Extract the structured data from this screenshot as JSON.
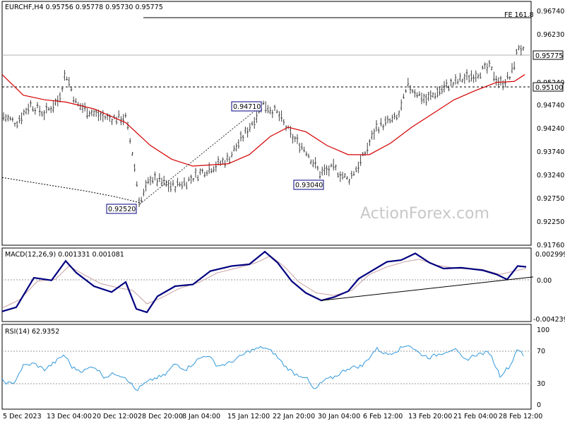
{
  "chart_data": {
    "type": "line",
    "watermark": "ActionForex.com",
    "price_panel": {
      "header": "EURCHF,H4  0.95756 0.95778 0.95730 0.95775",
      "ylim": [
        0.9162,
        0.9695
      ],
      "y_ticks": [
        "0.96740",
        "0.96230",
        "0.95775",
        "0.95240",
        "0.95100",
        "0.94740",
        "0.94240",
        "0.93740",
        "0.93240",
        "0.92750",
        "0.92250",
        "0.91760"
      ],
      "current_price": "0.95775",
      "support_level": "0.95100",
      "fe_label": "FE 161.8",
      "fe_level": 0.9659,
      "annotations": [
        {
          "text": "0.94710",
          "value": 0.9471
        },
        {
          "text": "0.93040",
          "value": 0.9304
        },
        {
          "text": "0.92520",
          "value": 0.9252
        }
      ],
      "price_path": [
        [
          0,
          0.9445
        ],
        [
          20,
          0.943
        ],
        [
          40,
          0.947
        ],
        [
          60,
          0.945
        ],
        [
          80,
          0.948
        ],
        [
          90,
          0.954
        ],
        [
          105,
          0.947
        ],
        [
          130,
          0.945
        ],
        [
          150,
          0.944
        ],
        [
          175,
          0.944
        ],
        [
          185,
          0.936
        ],
        [
          195,
          0.9252
        ],
        [
          210,
          0.931
        ],
        [
          240,
          0.929
        ],
        [
          260,
          0.93
        ],
        [
          280,
          0.932
        ],
        [
          320,
          0.935
        ],
        [
          350,
          0.942
        ],
        [
          370,
          0.9471
        ],
        [
          390,
          0.945
        ],
        [
          410,
          0.94
        ],
        [
          430,
          0.937
        ],
        [
          450,
          0.932
        ],
        [
          470,
          0.933
        ],
        [
          490,
          0.9304
        ],
        [
          510,
          0.935
        ],
        [
          530,
          0.942
        ],
        [
          560,
          0.944
        ],
        [
          575,
          0.951
        ],
        [
          600,
          0.948
        ],
        [
          630,
          0.951
        ],
        [
          660,
          0.953
        ],
        [
          690,
          0.955
        ],
        [
          705,
          0.9515
        ],
        [
          720,
          0.953
        ],
        [
          732,
          0.96
        ],
        [
          740,
          0.9578
        ]
      ],
      "ma_red": [
        [
          0,
          0.9535
        ],
        [
          30,
          0.949
        ],
        [
          60,
          0.948
        ],
        [
          90,
          0.9475
        ],
        [
          130,
          0.946
        ],
        [
          175,
          0.943
        ],
        [
          210,
          0.938
        ],
        [
          240,
          0.935
        ],
        [
          270,
          0.9335
        ],
        [
          320,
          0.934
        ],
        [
          350,
          0.936
        ],
        [
          380,
          0.94
        ],
        [
          405,
          0.942
        ],
        [
          430,
          0.941
        ],
        [
          460,
          0.938
        ],
        [
          490,
          0.936
        ],
        [
          520,
          0.936
        ],
        [
          550,
          0.9385
        ],
        [
          580,
          0.942
        ],
        [
          610,
          0.945
        ],
        [
          640,
          0.948
        ],
        [
          670,
          0.95
        ],
        [
          700,
          0.9518
        ],
        [
          725,
          0.952
        ],
        [
          740,
          0.9535
        ]
      ],
      "ma_dotted": [
        [
          0,
          0.931
        ],
        [
          40,
          0.93
        ],
        [
          80,
          0.929
        ],
        [
          120,
          0.928
        ],
        [
          160,
          0.9268
        ],
        [
          195,
          0.9255
        ]
      ],
      "trend_line": [
        [
          195,
          0.9252
        ],
        [
          370,
          0.9471
        ]
      ]
    },
    "macd_panel": {
      "header": "MACD(12,26,9) 0.001331 0.001081",
      "ylim": [
        -0.0052,
        0.00345
      ],
      "y_ticks": [
        "0.002999",
        "0.00",
        "-0.004239"
      ],
      "macd": [
        [
          0,
          -0.004
        ],
        [
          20,
          -0.0035
        ],
        [
          45,
          0.0
        ],
        [
          70,
          -0.0003
        ],
        [
          90,
          0.002
        ],
        [
          105,
          0.0006
        ],
        [
          130,
          -0.001
        ],
        [
          155,
          -0.0017
        ],
        [
          175,
          -0.0005
        ],
        [
          190,
          -0.0037
        ],
        [
          205,
          -0.0041
        ],
        [
          220,
          -0.0022
        ],
        [
          245,
          -0.001
        ],
        [
          270,
          -0.0008
        ],
        [
          295,
          0.0008
        ],
        [
          325,
          0.0014
        ],
        [
          350,
          0.0016
        ],
        [
          372,
          0.0031
        ],
        [
          390,
          0.0018
        ],
        [
          410,
          -0.0004
        ],
        [
          430,
          -0.0018
        ],
        [
          452,
          -0.0027
        ],
        [
          470,
          -0.0023
        ],
        [
          490,
          -0.0016
        ],
        [
          505,
          -0.0001
        ],
        [
          525,
          0.0009
        ],
        [
          545,
          0.0019
        ],
        [
          565,
          0.0021
        ],
        [
          585,
          0.0029
        ],
        [
          605,
          0.0018
        ],
        [
          625,
          0.0011
        ],
        [
          650,
          0.0012
        ],
        [
          680,
          0.0009
        ],
        [
          700,
          0.0004
        ],
        [
          715,
          -0.0002
        ],
        [
          730,
          0.0014
        ],
        [
          742,
          0.0013
        ]
      ],
      "signal": [
        [
          0,
          -0.0036
        ],
        [
          25,
          -0.0026
        ],
        [
          50,
          -0.0004
        ],
        [
          75,
          -0.0002
        ],
        [
          95,
          0.0014
        ],
        [
          115,
          0.0004
        ],
        [
          140,
          -0.0007
        ],
        [
          165,
          -0.0012
        ],
        [
          185,
          -0.0015
        ],
        [
          205,
          -0.0031
        ],
        [
          225,
          -0.0024
        ],
        [
          250,
          -0.0013
        ],
        [
          280,
          -0.0005
        ],
        [
          305,
          0.0006
        ],
        [
          335,
          0.0012
        ],
        [
          360,
          0.0018
        ],
        [
          380,
          0.0026
        ],
        [
          400,
          0.0013
        ],
        [
          420,
          -0.0005
        ],
        [
          445,
          -0.0018
        ],
        [
          470,
          -0.0021
        ],
        [
          495,
          -0.0015
        ],
        [
          520,
          0.0004
        ],
        [
          545,
          0.0013
        ],
        [
          570,
          0.0019
        ],
        [
          590,
          0.0022
        ],
        [
          615,
          0.0015
        ],
        [
          645,
          0.0011
        ],
        [
          680,
          0.001
        ],
        [
          705,
          0.0004
        ],
        [
          725,
          0.0008
        ],
        [
          742,
          0.0011
        ]
      ],
      "trend_line": [
        [
          452,
          -0.0027
        ],
        [
          752,
          0.0001
        ]
      ]
    },
    "rsi_panel": {
      "header": "RSI(14) 62.9352",
      "ylim": [
        0,
        100
      ],
      "y_ticks": [
        "100",
        "70",
        "30",
        "0"
      ],
      "levels": [
        70,
        30
      ],
      "rsi": [
        [
          0,
          35
        ],
        [
          15,
          30
        ],
        [
          30,
          55
        ],
        [
          45,
          58
        ],
        [
          60,
          50
        ],
        [
          75,
          60
        ],
        [
          88,
          70
        ],
        [
          100,
          52
        ],
        [
          115,
          48
        ],
        [
          130,
          55
        ],
        [
          145,
          40
        ],
        [
          160,
          45
        ],
        [
          175,
          40
        ],
        [
          190,
          22
        ],
        [
          200,
          30
        ],
        [
          215,
          38
        ],
        [
          230,
          42
        ],
        [
          245,
          58
        ],
        [
          260,
          50
        ],
        [
          275,
          62
        ],
        [
          290,
          70
        ],
        [
          305,
          55
        ],
        [
          320,
          58
        ],
        [
          335,
          66
        ],
        [
          350,
          75
        ],
        [
          370,
          80
        ],
        [
          385,
          72
        ],
        [
          400,
          55
        ],
        [
          415,
          44
        ],
        [
          430,
          40
        ],
        [
          442,
          22
        ],
        [
          455,
          35
        ],
        [
          470,
          40
        ],
        [
          490,
          52
        ],
        [
          510,
          55
        ],
        [
          530,
          78
        ],
        [
          545,
          70
        ],
        [
          560,
          76
        ],
        [
          575,
          84
        ],
        [
          590,
          72
        ],
        [
          605,
          66
        ],
        [
          625,
          73
        ],
        [
          640,
          78
        ],
        [
          655,
          62
        ],
        [
          670,
          70
        ],
        [
          690,
          73
        ],
        [
          705,
          42
        ],
        [
          720,
          56
        ],
        [
          730,
          80
        ],
        [
          740,
          64
        ]
      ]
    },
    "x_ticks": [
      "5 Dec 2023",
      "13 Dec 04:00",
      "20 Dec 12:00",
      "28 Dec 20:00",
      "8 Jan 04:00",
      "15 Jan 12:00",
      "22 Jan 20:00",
      "30 Jan 04:00",
      "6 Feb 12:00",
      "13 Feb 20:00",
      "21 Feb 04:00",
      "28 Feb 12:00"
    ],
    "colors": {
      "bars": "#404040",
      "ma_red": "#d40000",
      "macd": "#000080",
      "signal": "#c8a0a0",
      "rsi": "#3399dd",
      "trend": "#000000"
    }
  }
}
